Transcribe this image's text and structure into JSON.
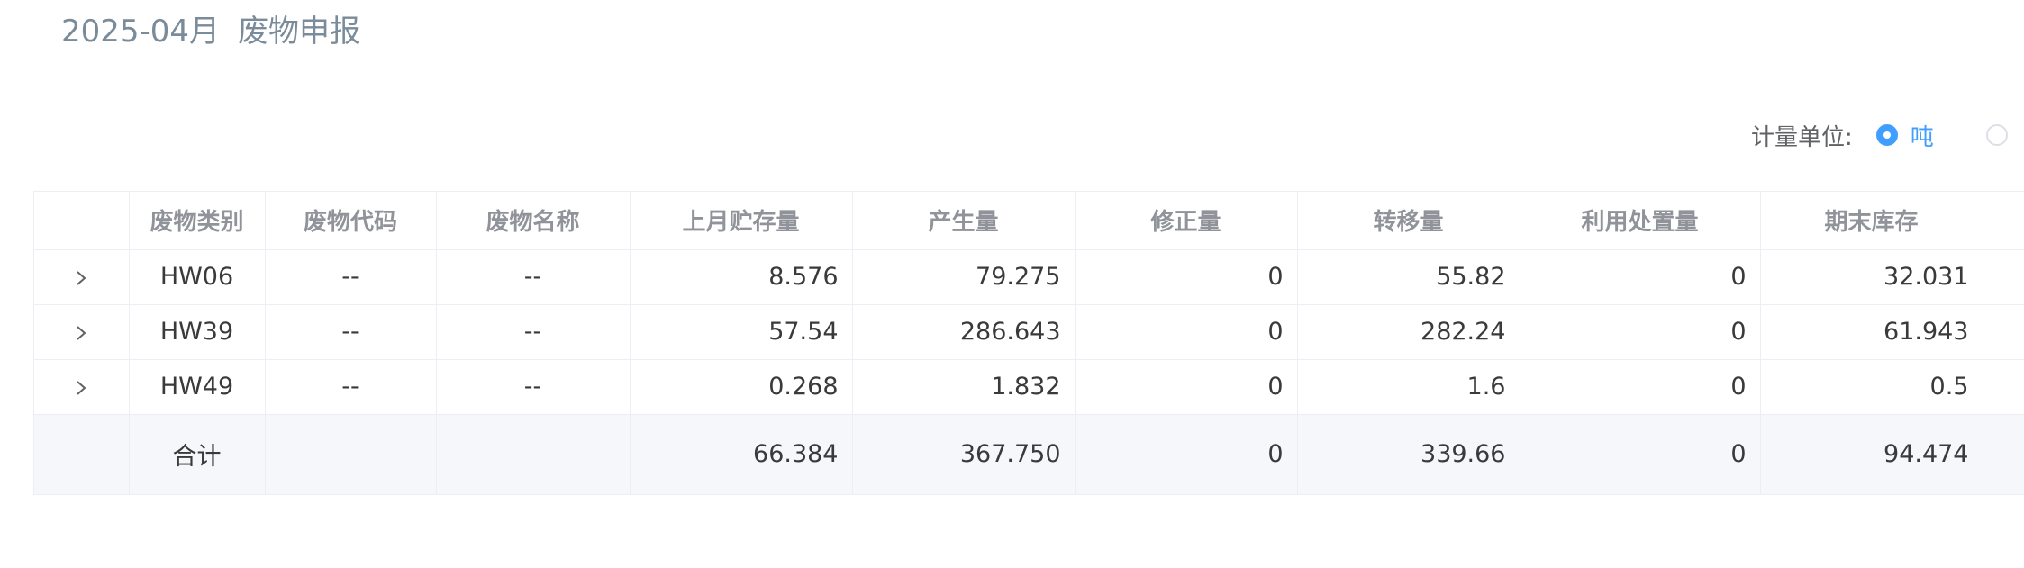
{
  "header": {
    "period": "2025-04月",
    "title": "废物申报"
  },
  "unit_selector": {
    "label": "计量单位:",
    "options": [
      {
        "label": "吨",
        "selected": true
      },
      {
        "label": "",
        "selected": false
      }
    ]
  },
  "table": {
    "columns": [
      "",
      "废物类别",
      "废物代码",
      "废物名称",
      "上月贮存量",
      "产生量",
      "修正量",
      "转移量",
      "利用处置量",
      "期末库存",
      ""
    ],
    "rows": [
      {
        "category": "HW06",
        "code": "--",
        "name": "--",
        "last_month_storage": "8.576",
        "generated": "79.275",
        "corrected": "0",
        "transferred": "55.82",
        "utilized": "0",
        "ending_stock": "32.031"
      },
      {
        "category": "HW39",
        "code": "--",
        "name": "--",
        "last_month_storage": "57.54",
        "generated": "286.643",
        "corrected": "0",
        "transferred": "282.24",
        "utilized": "0",
        "ending_stock": "61.943"
      },
      {
        "category": "HW49",
        "code": "--",
        "name": "--",
        "last_month_storage": "0.268",
        "generated": "1.832",
        "corrected": "0",
        "transferred": "1.6",
        "utilized": "0",
        "ending_stock": "0.5"
      }
    ],
    "total": {
      "label": "合计",
      "last_month_storage": "66.384",
      "generated": "367.750",
      "corrected": "0",
      "transferred": "339.66",
      "utilized": "0",
      "ending_stock": "94.474"
    }
  },
  "icons": {
    "expand": "chevron-right-icon"
  },
  "colors": {
    "accent": "#409eff",
    "title": "#7a8b99",
    "header_text": "#909399",
    "border": "#ebeef5",
    "total_row_bg": "#f5f7fa"
  }
}
